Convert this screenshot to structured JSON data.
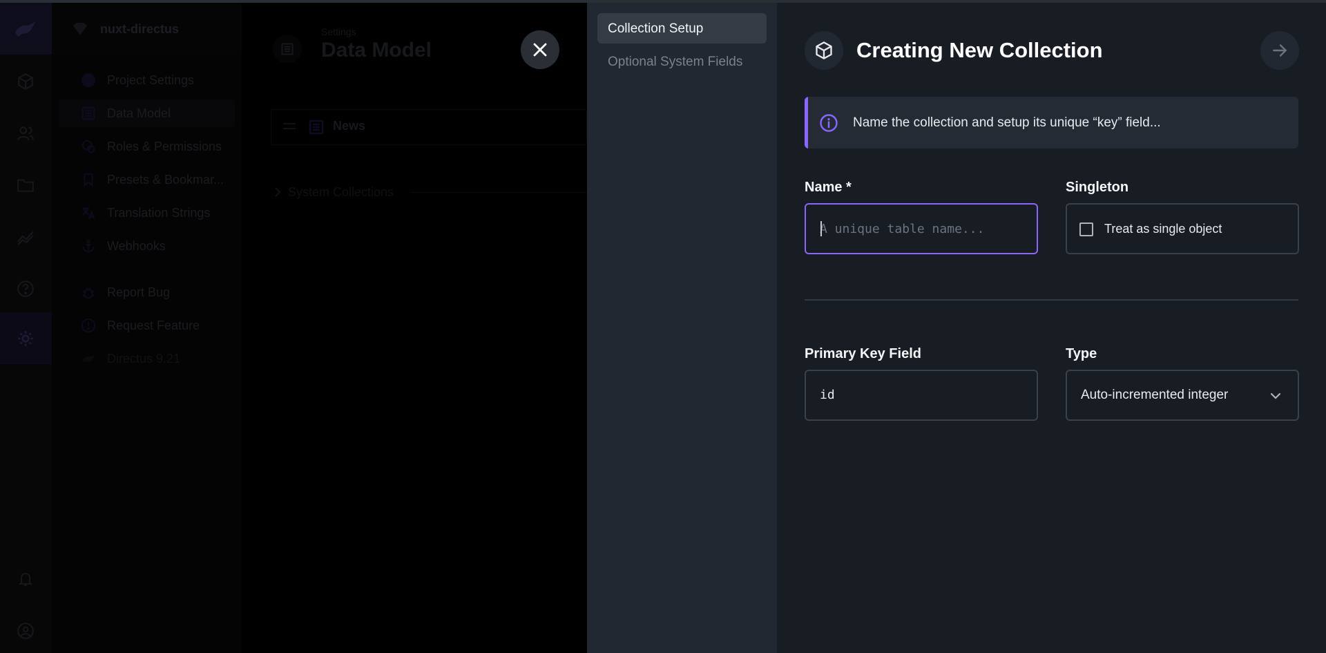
{
  "background": {
    "project_name": "nuxt-directus",
    "nav_items": [
      {
        "label": "Project Settings"
      },
      {
        "label": "Data Model"
      },
      {
        "label": "Roles & Permissions"
      },
      {
        "label": "Presets & Bookmar..."
      },
      {
        "label": "Translation Strings"
      },
      {
        "label": "Webhooks"
      },
      {
        "label": "Report Bug"
      },
      {
        "label": "Request Feature"
      },
      {
        "label": "Directus 9.21"
      }
    ],
    "header_subtitle": "Settings",
    "header_title": "Data Model",
    "collection_name": "News",
    "system_collections_label": "System Collections"
  },
  "drawer": {
    "nav": [
      {
        "label": "Collection Setup",
        "active": true
      },
      {
        "label": "Optional System Fields",
        "active": false
      }
    ],
    "title": "Creating New Collection",
    "notice": "Name the collection and setup its unique “key” field...",
    "name_label": "Name *",
    "name_placeholder": "A unique table name...",
    "name_value": "",
    "singleton_label": "Singleton",
    "singleton_checkbox_label": "Treat as single object",
    "singleton_checked": false,
    "pk_label": "Primary Key Field",
    "pk_value": "id",
    "type_label": "Type",
    "type_value": "Auto-incremented integer"
  },
  "colors": {
    "accent": "#8866ff",
    "drawer_bg": "#181c23",
    "drawer_nav_bg": "#222831"
  }
}
